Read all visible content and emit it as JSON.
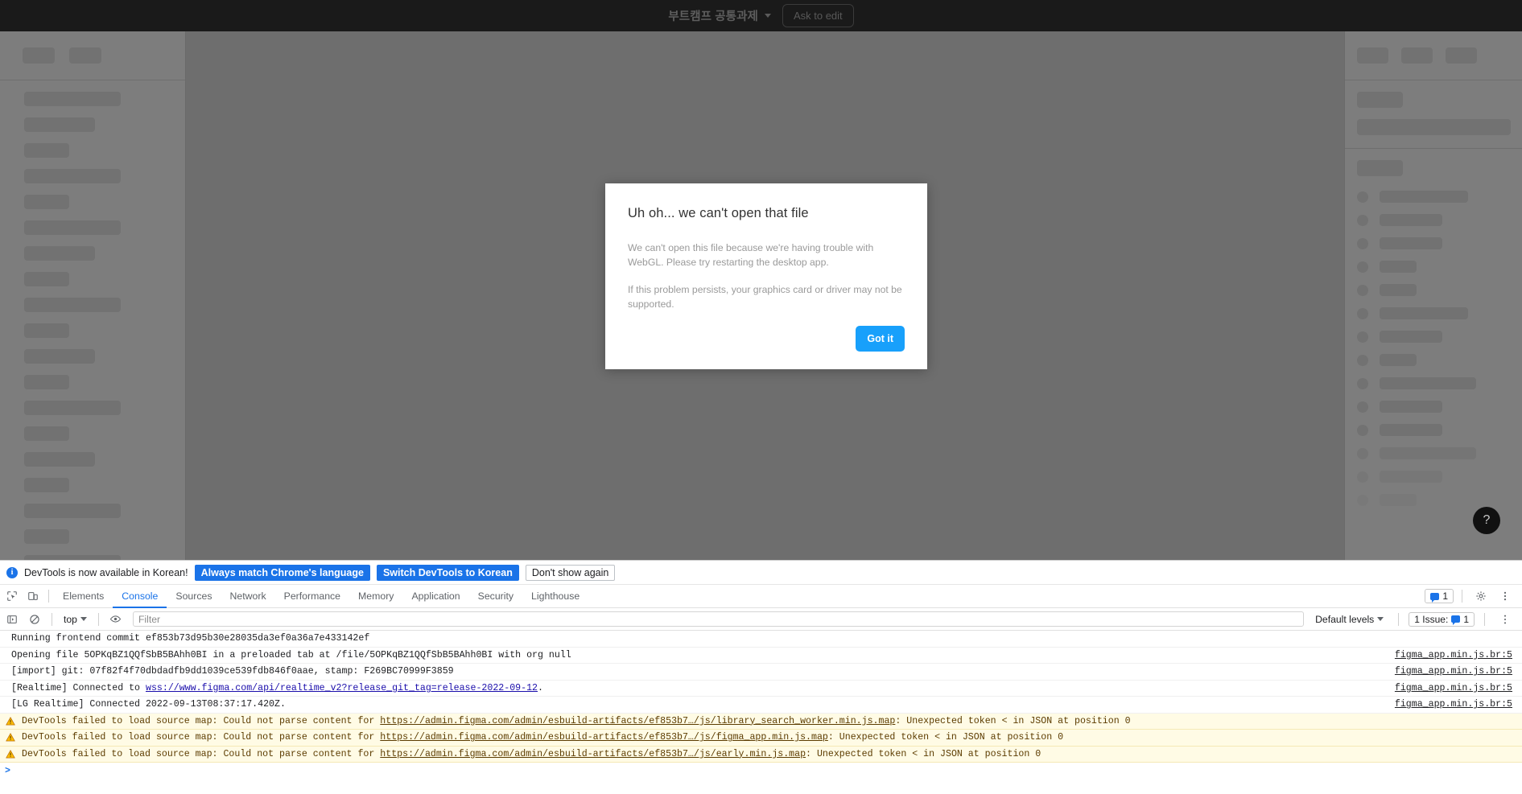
{
  "figma": {
    "topbar": {
      "doc_title": "부트캠프 공통과제",
      "chevron_icon": "chevron-down-icon",
      "ask_to_edit_label": "Ask to edit"
    },
    "help_button_label": "?",
    "accent": "#18a0fb",
    "canvas_bg": "#6e6e6e",
    "panel_bg": "#7d7d7d",
    "topbar_bg": "#1a1a1a"
  },
  "modal": {
    "title": "Uh oh... we can't open that file",
    "paragraph1": "We can't open this file because we're having trouble with WebGL. Please try restarting the desktop app.",
    "paragraph2": "If this problem persists, your graphics card or driver may not be supported.",
    "confirm_label": "Got it",
    "confirm_color": "#18a0fb"
  },
  "devtools": {
    "infobar": {
      "message": "DevTools is now available in Korean!",
      "btn_always_match": "Always match Chrome's language",
      "btn_switch": "Switch DevTools to Korean",
      "btn_dont_show": "Don't show again",
      "info_icon": "info-icon"
    },
    "tabs": [
      {
        "label": "Elements",
        "active": false
      },
      {
        "label": "Console",
        "active": true
      },
      {
        "label": "Sources",
        "active": false
      },
      {
        "label": "Network",
        "active": false
      },
      {
        "label": "Performance",
        "active": false
      },
      {
        "label": "Memory",
        "active": false
      },
      {
        "label": "Application",
        "active": false
      },
      {
        "label": "Security",
        "active": false
      },
      {
        "label": "Lighthouse",
        "active": false
      }
    ],
    "tabs_right": {
      "message_count": "1",
      "gear_icon": "gear-icon",
      "more_icon": "kebab-menu-icon",
      "inspect_icon": "inspect-element-icon",
      "device_icon": "device-toolbar-icon"
    },
    "filterbar": {
      "sidebar_icon": "console-sidebar-icon",
      "clear_icon": "clear-console-icon",
      "context_value": "top",
      "eye_icon": "live-expression-eye-icon",
      "filter_placeholder": "Filter",
      "filter_value": "",
      "levels_label": "Default levels",
      "issues_label": "1 Issue:",
      "issues_count": "1",
      "settings_icon": "devtools-settings-icon"
    },
    "console_rows": [
      {
        "level": "log",
        "text": "Running frontend commit ef853b73d95b30e28035da3ef0a36a7e433142ef",
        "source": ""
      },
      {
        "level": "log",
        "text": "Opening file 5OPKqBZ1QQfSbB5BAhh0BI in a preloaded tab at /file/5OPKqBZ1QQfSbB5BAhh0BI with org null",
        "source": "figma_app.min.js.br:5"
      },
      {
        "level": "log",
        "text": "[import] git: 07f82f4f70dbdadfb9dd1039ce539fdb846f0aae, stamp: F269BC70999F3859",
        "source": "figma_app.min.js.br:5"
      },
      {
        "level": "log",
        "prefix": "[Realtime] Connected to ",
        "link": "wss://www.figma.com/api/realtime_v2?release_git_tag=release-2022-09-12",
        "suffix": ".",
        "source": "figma_app.min.js.br:5"
      },
      {
        "level": "log",
        "text": "[LG Realtime] Connected 2022-09-13T08:37:17.420Z.",
        "source": "figma_app.min.js.br:5"
      },
      {
        "level": "warn",
        "prefix": "DevTools failed to load source map: Could not parse content for ",
        "link": "https://admin.figma.com/admin/esbuild-artifacts/ef853b7…/js/library_search_worker.min.js.map",
        "suffix": ": Unexpected token < in JSON at position 0",
        "source": ""
      },
      {
        "level": "warn",
        "prefix": "DevTools failed to load source map: Could not parse content for ",
        "link": "https://admin.figma.com/admin/esbuild-artifacts/ef853b7…/js/figma_app.min.js.map",
        "suffix": ": Unexpected token < in JSON at position 0",
        "source": ""
      },
      {
        "level": "warn",
        "prefix": "DevTools failed to load source map: Could not parse content for ",
        "link": "https://admin.figma.com/admin/esbuild-artifacts/ef853b7…/js/early.min.js.map",
        "suffix": ": Unexpected token < in JSON at position 0",
        "source": ""
      }
    ],
    "prompt_symbol": ">"
  }
}
